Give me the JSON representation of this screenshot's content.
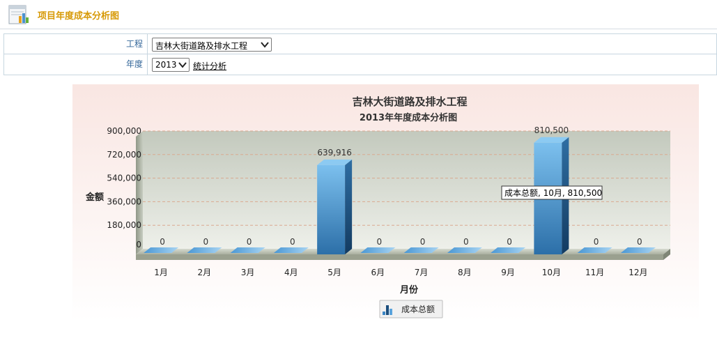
{
  "header": {
    "title": "项目年度成本分析图",
    "icon": "bar-chart-report-icon"
  },
  "filters": {
    "project_label": "工程",
    "project_value": "吉林大街道路及排水工程",
    "year_label": "年度",
    "year_value": "2013",
    "analyze_link": "统计分析"
  },
  "colors": {
    "header_title": "#d79a08",
    "label": "#336699",
    "bar_front": "#3b86c4",
    "bar_side": "#1b4e7d",
    "bar_top": "#7cc0ee"
  },
  "chart_data": {
    "type": "bar",
    "title": "吉林大街道路及排水工程",
    "subtitle": "2013年年度成本分析图",
    "xlabel": "月份",
    "ylabel": "金额",
    "categories": [
      "1月",
      "2月",
      "3月",
      "4月",
      "5月",
      "6月",
      "7月",
      "8月",
      "9月",
      "10月",
      "11月",
      "12月"
    ],
    "series": [
      {
        "name": "成本总额",
        "values": [
          0,
          0,
          0,
          0,
          639916,
          0,
          0,
          0,
          0,
          810500,
          0,
          0
        ]
      }
    ],
    "data_labels": [
      "0",
      "0",
      "0",
      "0",
      "639,916",
      "0",
      "0",
      "0",
      "0",
      "810,500",
      "0",
      "0"
    ],
    "ylim": [
      0,
      900000
    ],
    "yticks": [
      0,
      180000,
      360000,
      540000,
      720000,
      900000
    ],
    "ytick_labels": [
      "0",
      "180,000",
      "360,000",
      "540,000",
      "720,000",
      "900,000"
    ],
    "grid": true,
    "legend": "bottom-center",
    "tooltip": {
      "text": "成本总额, 10月, 810,500",
      "index": 9
    }
  }
}
